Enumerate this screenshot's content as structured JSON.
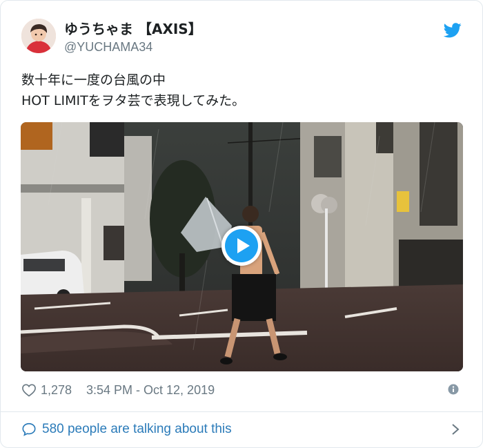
{
  "tweet": {
    "author": {
      "display_name": "ゆうちゃま 【AXIS】",
      "handle": "@YUCHAMA34"
    },
    "text_lines": [
      "数十年に一度の台風の中",
      "HOT LIMITをヲタ芸で表現してみた。"
    ],
    "media": {
      "type": "video",
      "play_icon": "play-icon"
    },
    "likes": "1,278",
    "timestamp": "3:54 PM - Oct 12, 2019",
    "talking": "580 people are talking about this"
  },
  "icons": {
    "brand": "twitter-bird-icon",
    "like": "heart-icon",
    "info": "info-icon",
    "reply": "speech-bubble-icon",
    "more": "chevron-right-icon"
  },
  "colors": {
    "brand_blue": "#1da1f2",
    "link_blue": "#2b7bb9",
    "muted_gray": "#697882",
    "text": "#1c2022",
    "border": "#e1e8ed"
  }
}
